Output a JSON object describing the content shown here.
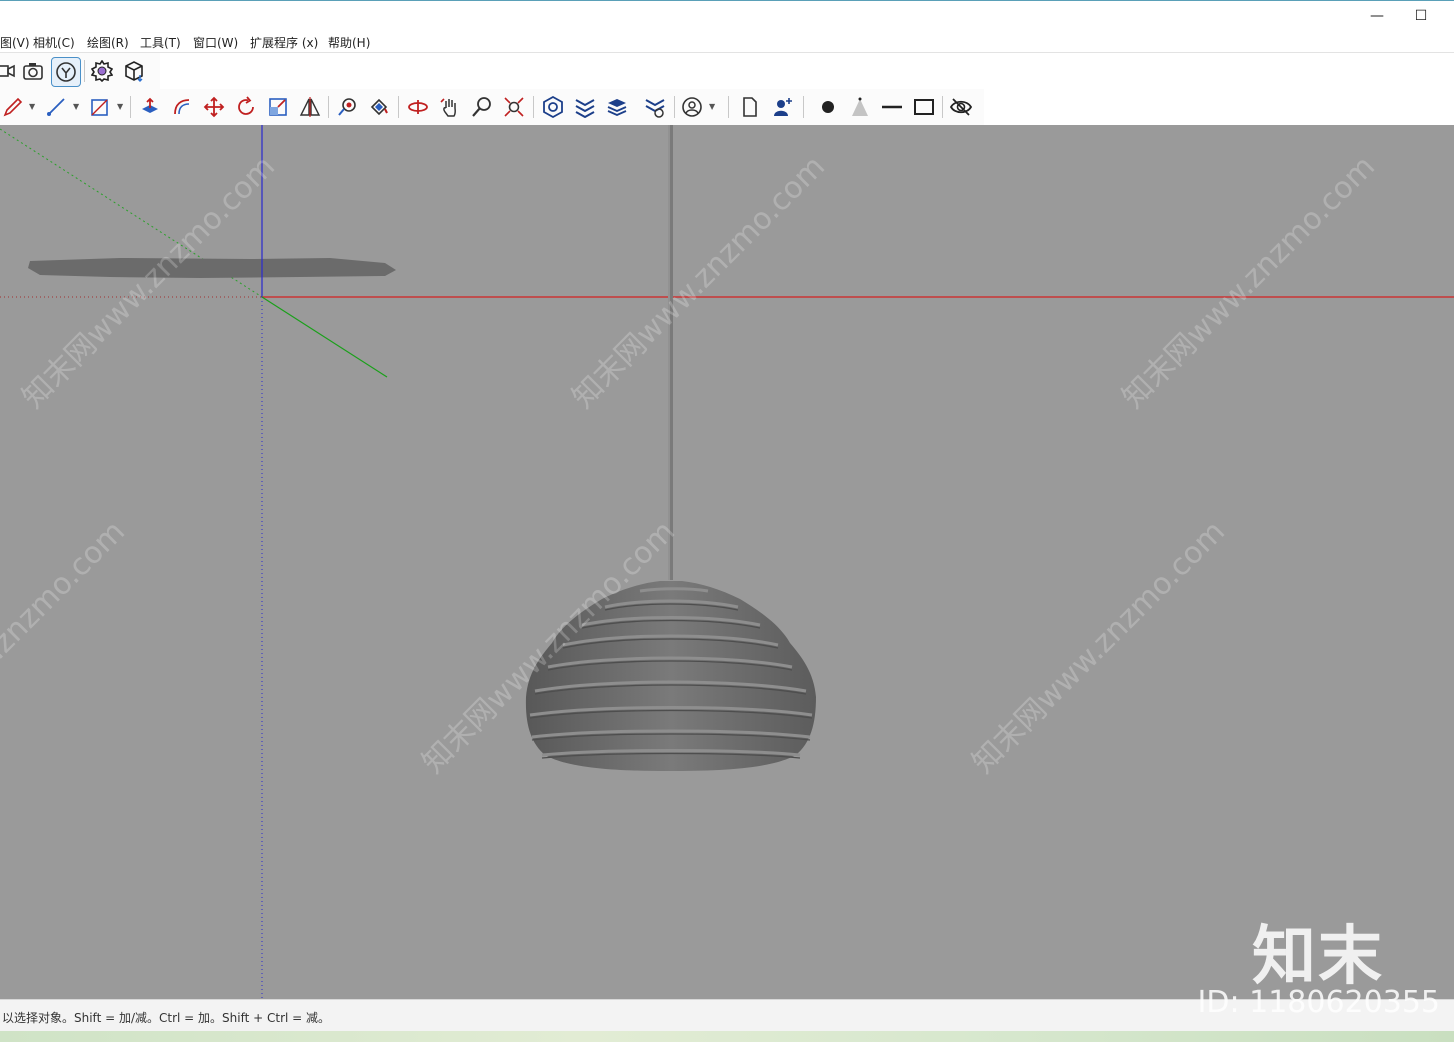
{
  "window": {
    "minimize_glyph": "—",
    "maximize_glyph": "☐"
  },
  "menu": {
    "items": [
      "图(V)",
      "相机(C)",
      "绘图(R)",
      "工具(T)",
      "窗口(W)",
      "扩展程序 (x)",
      "帮助(H)"
    ]
  },
  "toolbar_top": {
    "icons": [
      "video-camera-icon",
      "camera-icon",
      "y-axis-view-icon",
      "settings-gear-icon",
      "3d-box-icon"
    ]
  },
  "toolbar_main": {
    "icons": [
      "pencil-icon",
      "line-tool-icon",
      "rectangle-tool-icon",
      "push-pull-icon",
      "follow-me-icon",
      "move-icon",
      "rotate-icon",
      "scale-icon",
      "flip-icon",
      "tape-measure-icon",
      "paint-bucket-icon",
      "orbit-icon",
      "pan-icon",
      "zoom-icon",
      "zoom-extents-icon",
      "warehouse-icon",
      "sandbox-icon",
      "layers-icon",
      "styles-icon",
      "account-icon",
      "new-page-icon",
      "add-user-icon",
      "dot-icon",
      "cone-icon",
      "line-icon",
      "rectangle-icon",
      "hide-icon"
    ]
  },
  "viewport": {
    "background": "#9a9a9a",
    "axis_colors": {
      "red": "#d42020",
      "green": "#1aa01a",
      "blue": "#2020c8"
    }
  },
  "watermark": {
    "text": "知末网www.znzmo.com"
  },
  "brand": {
    "logo_text": "知末",
    "id_text": "ID: 1180620355"
  },
  "status": {
    "text": "以选择对象。Shift = 加/减。Ctrl = 加。Shift + Ctrl = 减。"
  }
}
